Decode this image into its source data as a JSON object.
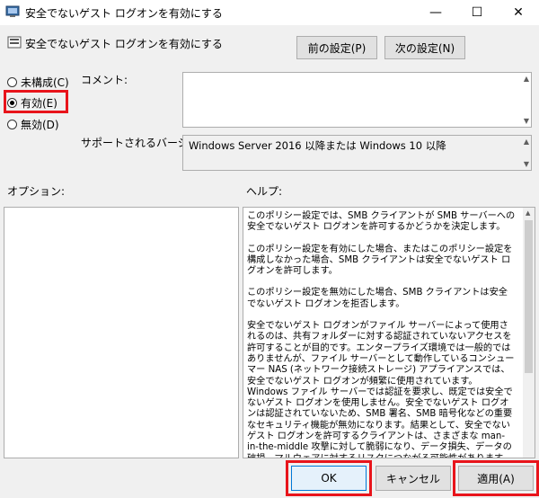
{
  "window": {
    "title": "安全でないゲスト ログオンを有効にする",
    "min_glyph": "—",
    "max_glyph": "☐",
    "close_glyph": "✕"
  },
  "header": {
    "policy_title": "安全でないゲスト ログオンを有効にする",
    "prev_button": "前の設定(P)",
    "next_button": "次の設定(N)"
  },
  "state": {
    "options": [
      {
        "label": "未構成(C)",
        "selected": false
      },
      {
        "label": "有効(E)",
        "selected": true
      },
      {
        "label": "無効(D)",
        "selected": false
      }
    ]
  },
  "comment": {
    "label": "コメント:",
    "value": ""
  },
  "supported": {
    "label": "サポートされるバージョン:",
    "value": "Windows Server 2016 以降または Windows 10 以降"
  },
  "options_panel": {
    "label": "オプション:"
  },
  "help": {
    "label": "ヘルプ:",
    "paragraphs": [
      "このポリシー設定では、SMB クライアントが SMB サーバーへの安全でないゲスト ログオンを許可するかどうかを決定します。",
      "このポリシー設定を有効にした場合、またはこのポリシー設定を構成しなかった場合、SMB クライアントは安全でないゲスト ログオンを許可します。",
      "このポリシー設定を無効にした場合、SMB クライアントは安全でないゲスト ログオンを拒否します。",
      "安全でないゲスト ログオンがファイル サーバーによって使用されるのは、共有フォルダーに対する認証されていないアクセスを許可することが目的です。エンタープライズ環境では一般的ではありませんが、ファイル サーバーとして動作しているコンシューマー NAS (ネットワーク接続ストレージ) アプライアンスでは、安全でないゲスト ログオンが頻繁に使用されています。Windows ファイル サーバーでは認証を要求し、既定では安全でないゲスト ログオンを使用しません。安全でないゲスト ログオンは認証されていないため、SMB 署名、SMB 暗号化などの重要なセキュリティ機能が無効になります。結果として、安全でないゲスト ログオンを許可するクライアントは、さまざまな man-in-the-middle 攻撃に対して脆弱になり、データ損失、データの破損、マルウェアに対するリスクにつながる可能性があります。また、安全でないゲスト ログオンを使用してファイル サーバーに書き込まれ"
    ]
  },
  "footer": {
    "ok": "OK",
    "cancel": "キャンセル",
    "apply": "適用(A)"
  },
  "colors": {
    "highlight": "#e8141b",
    "accent": "#0078d7"
  }
}
